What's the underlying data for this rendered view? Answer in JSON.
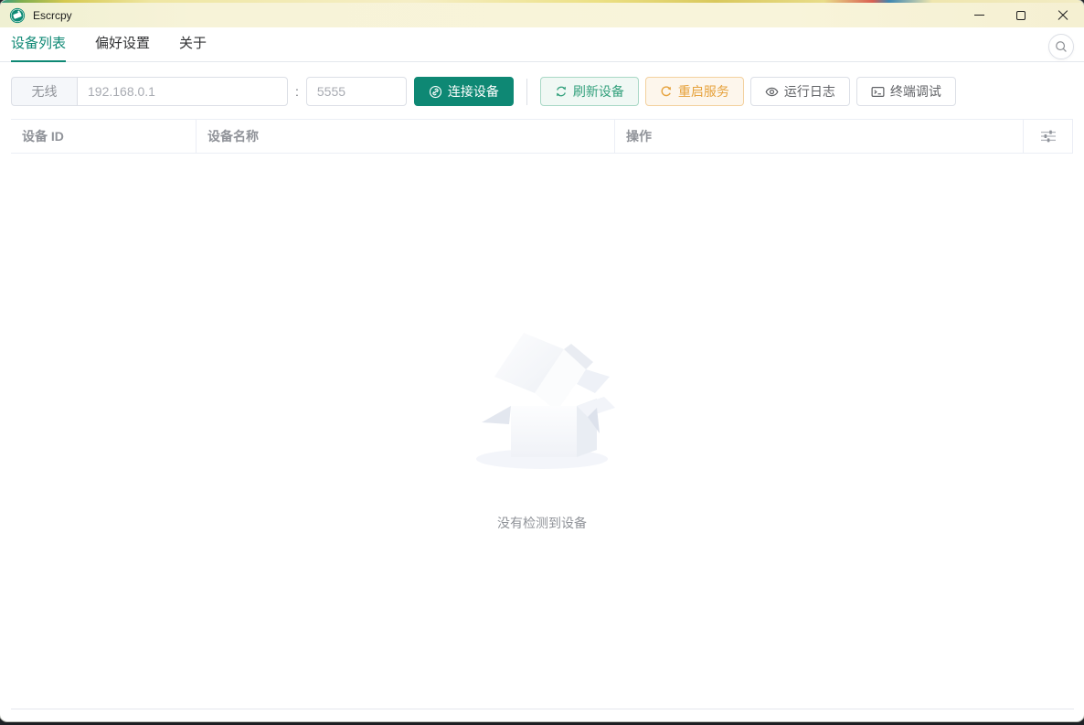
{
  "titlebar": {
    "app_title": "Escrcpy"
  },
  "tabs": [
    {
      "label": "设备列表",
      "active": true
    },
    {
      "label": "偏好设置",
      "active": false
    },
    {
      "label": "关于",
      "active": false
    }
  ],
  "toolbar": {
    "wireless_label": "无线",
    "ip_placeholder": "192.168.0.1",
    "port_separator": ":",
    "port_placeholder": "5555",
    "connect_label": "连接设备",
    "refresh_label": "刷新设备",
    "restart_label": "重启服务",
    "logs_label": "运行日志",
    "terminal_label": "终端调试"
  },
  "table": {
    "columns": [
      "设备 ID",
      "设备名称",
      "操作"
    ]
  },
  "empty": {
    "message": "没有检测到设备"
  },
  "icons": {
    "app_logo": "teal-circle-device",
    "minimize": "horizontal-bar",
    "maximize": "square-outline",
    "close": "x-cross",
    "search": "magnifier",
    "connect": "circle-link",
    "refresh": "cycle-arrows",
    "restart": "circular-arrow",
    "logs": "eye",
    "terminal": "terminal-window",
    "column_settings": "sliders"
  },
  "colors": {
    "primary": "#0e8874",
    "titlebar_bg": "#f7f3d8",
    "success_text": "#34a17d",
    "warning_text": "#e6a23c",
    "muted_text": "#909399",
    "placeholder": "#a8abb2",
    "border": "#dcdfe6",
    "table_border": "#ebeef5"
  }
}
